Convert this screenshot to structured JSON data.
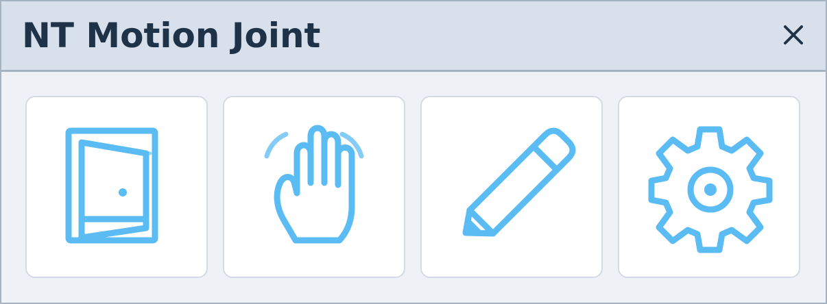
{
  "dialog": {
    "title": "NT Motion Joint",
    "close_icon": "close-icon"
  },
  "actions": [
    {
      "name": "door-open-button",
      "icon": "door-icon"
    },
    {
      "name": "hand-wave-button",
      "icon": "hand-wave-icon"
    },
    {
      "name": "edit-button",
      "icon": "pencil-icon"
    },
    {
      "name": "settings-button",
      "icon": "gear-icon"
    }
  ],
  "colors": {
    "icon_accent": "#5bbcf4",
    "title_text": "#1e3347",
    "titlebar_bg": "#d7e0eb",
    "border": "#a6b3c1"
  }
}
